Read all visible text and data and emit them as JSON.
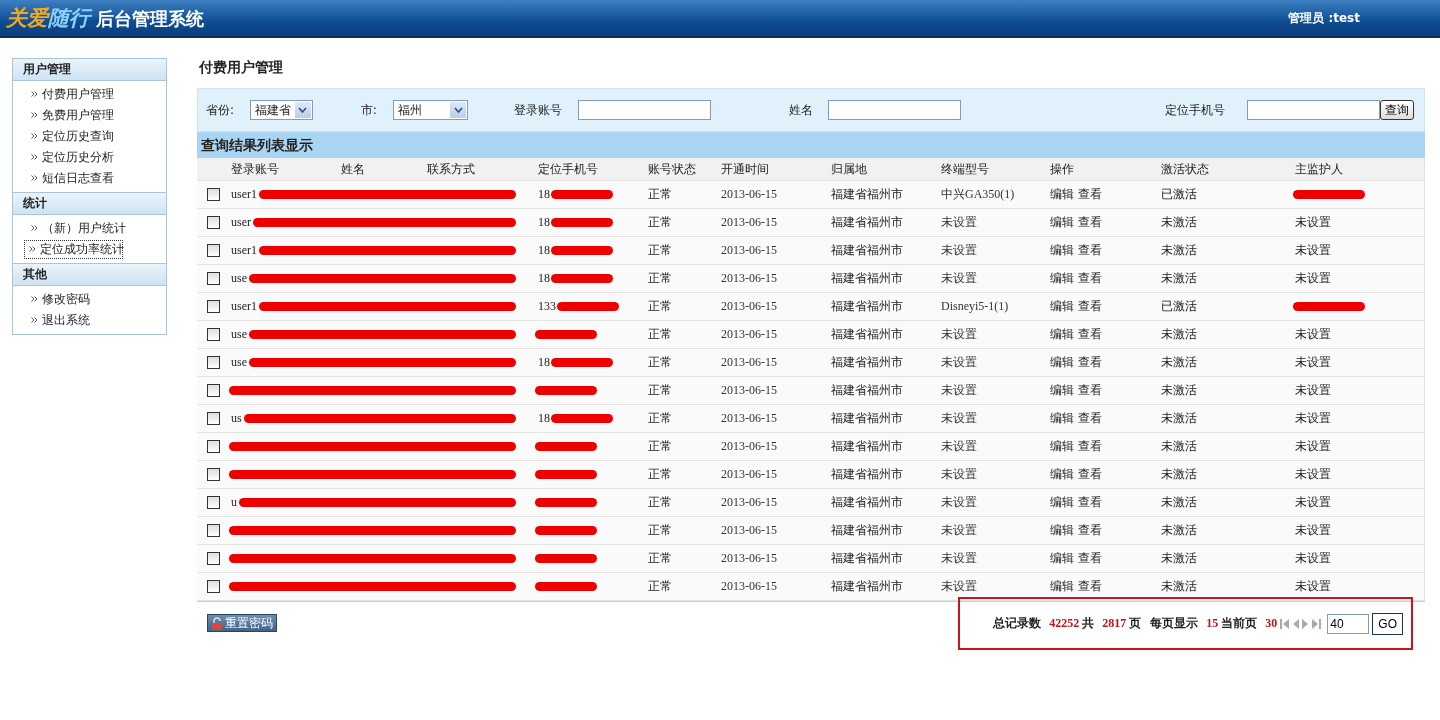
{
  "header": {
    "logo_part_1": "关爱",
    "logo_part_2": "随行",
    "system_name": "后台管理系统",
    "admin": "管理员 :test"
  },
  "sidebar": [
    {
      "title": "用户管理",
      "items": [
        {
          "label": "付费用户管理",
          "focused": false
        },
        {
          "label": "免费用户管理",
          "focused": false
        },
        {
          "label": "定位历史查询",
          "focused": false
        },
        {
          "label": "定位历史分析",
          "focused": false
        },
        {
          "label": "短信日志查看",
          "focused": false
        }
      ]
    },
    {
      "title": "统计",
      "items": [
        {
          "label": "（新）用户统计",
          "focused": false
        },
        {
          "label": "定位成功率统计",
          "focused": true
        }
      ]
    },
    {
      "title": "其他",
      "items": [
        {
          "label": "修改密码",
          "focused": false
        },
        {
          "label": "退出系统",
          "focused": false
        }
      ]
    }
  ],
  "page_title": "付费用户管理",
  "filters": {
    "province_label": "省份:",
    "province": "福建省",
    "city_label": "市:",
    "city": "福州",
    "account_label": "登录账号",
    "name_label": "姓名",
    "phone_label": "定位手机号",
    "query_button": "查询"
  },
  "results_title": "查询结果列表显示",
  "columns": [
    "登录账号",
    "姓名",
    "联系方式",
    "定位手机号",
    "账号状态",
    "开通时间",
    "归属地",
    "终端型号",
    "操作",
    "激活状态",
    "主监护人"
  ],
  "rows": [
    {
      "checked": false,
      "account": "user1",
      "phone": "18",
      "status": "正常",
      "date": "2013-06-15",
      "region": "福建省福州市",
      "terminal": "中兴GA350(1)",
      "edit": "编辑",
      "view": "查看",
      "activation": "已激活",
      "activated": true,
      "guardian": "",
      "guardian_redacted": true
    },
    {
      "checked": false,
      "account": "user",
      "phone": "18",
      "status": "正常",
      "date": "2013-06-15",
      "region": "福建省福州市",
      "terminal": "未设置",
      "edit": "编辑",
      "view": "查看",
      "activation": "未激活",
      "activated": false,
      "guardian": "未设置",
      "guardian_redacted": false
    },
    {
      "checked": false,
      "account": "user1",
      "phone": "18",
      "status": "正常",
      "date": "2013-06-15",
      "region": "福建省福州市",
      "terminal": "未设置",
      "edit": "编辑",
      "view": "查看",
      "activation": "未激活",
      "activated": false,
      "guardian": "未设置",
      "guardian_redacted": false
    },
    {
      "checked": false,
      "account": "use",
      "phone": "18",
      "status": "正常",
      "date": "2013-06-15",
      "region": "福建省福州市",
      "terminal": "未设置",
      "edit": "编辑",
      "view": "查看",
      "activation": "未激活",
      "activated": false,
      "guardian": "未设置",
      "guardian_redacted": false
    },
    {
      "checked": false,
      "account": "user1",
      "phone": "133",
      "status": "正常",
      "date": "2013-06-15",
      "region": "福建省福州市",
      "terminal": "Disneyi5-1(1)",
      "edit": "编辑",
      "view": "查看",
      "activation": "已激活",
      "activated": true,
      "guardian": "",
      "guardian_redacted": true
    },
    {
      "checked": false,
      "account": "use",
      "phone": "",
      "status": "正常",
      "date": "2013-06-15",
      "region": "福建省福州市",
      "terminal": "未设置",
      "edit": "编辑",
      "view": "查看",
      "activation": "未激活",
      "activated": false,
      "guardian": "未设置",
      "guardian_redacted": false
    },
    {
      "checked": false,
      "account": "use",
      "phone": "18",
      "status": "正常",
      "date": "2013-06-15",
      "region": "福建省福州市",
      "terminal": "未设置",
      "edit": "编辑",
      "view": "查看",
      "activation": "未激活",
      "activated": false,
      "guardian": "未设置",
      "guardian_redacted": false
    },
    {
      "checked": false,
      "account": "",
      "phone": "",
      "status": "正常",
      "date": "2013-06-15",
      "region": "福建省福州市",
      "terminal": "未设置",
      "edit": "编辑",
      "view": "查看",
      "activation": "未激活",
      "activated": false,
      "guardian": "未设置",
      "guardian_redacted": false
    },
    {
      "checked": false,
      "account": "us",
      "phone": "18",
      "status": "正常",
      "date": "2013-06-15",
      "region": "福建省福州市",
      "terminal": "未设置",
      "edit": "编辑",
      "view": "查看",
      "activation": "未激活",
      "activated": false,
      "guardian": "未设置",
      "guardian_redacted": false
    },
    {
      "checked": false,
      "account": "",
      "phone": "",
      "status": "正常",
      "date": "2013-06-15",
      "region": "福建省福州市",
      "terminal": "未设置",
      "edit": "编辑",
      "view": "查看",
      "activation": "未激活",
      "activated": false,
      "guardian": "未设置",
      "guardian_redacted": false
    },
    {
      "checked": false,
      "account": "",
      "phone": "",
      "status": "正常",
      "date": "2013-06-15",
      "region": "福建省福州市",
      "terminal": "未设置",
      "edit": "编辑",
      "view": "查看",
      "activation": "未激活",
      "activated": false,
      "guardian": "未设置",
      "guardian_redacted": false
    },
    {
      "checked": false,
      "account": "u",
      "phone": "",
      "status": "正常",
      "date": "2013-06-15",
      "region": "福建省福州市",
      "terminal": "未设置",
      "edit": "编辑",
      "view": "查看",
      "activation": "未激活",
      "activated": false,
      "guardian": "未设置",
      "guardian_redacted": false
    },
    {
      "checked": false,
      "account": "",
      "phone": "",
      "status": "正常",
      "date": "2013-06-15",
      "region": "福建省福州市",
      "terminal": "未设置",
      "edit": "编辑",
      "view": "查看",
      "activation": "未激活",
      "activated": false,
      "guardian": "未设置",
      "guardian_redacted": false
    },
    {
      "checked": false,
      "account": "",
      "phone": "",
      "status": "正常",
      "date": "2013-06-15",
      "region": "福建省福州市",
      "terminal": "未设置",
      "edit": "编辑",
      "view": "查看",
      "activation": "未激活",
      "activated": false,
      "guardian": "未设置",
      "guardian_redacted": false
    },
    {
      "checked": false,
      "account": "",
      "phone": "",
      "status": "正常",
      "date": "2013-06-15",
      "region": "福建省福州市",
      "terminal": "未设置",
      "edit": "编辑",
      "view": "查看",
      "activation": "未激活",
      "activated": false,
      "guardian": "未设置",
      "guardian_redacted": false
    }
  ],
  "reset_button": "重置密码",
  "pagination": {
    "total_label": "总记录数",
    "total": "42252",
    "pages_label": "共",
    "pages": "2817",
    "pages_unit": "页",
    "per_page_label": "每页显示",
    "per_page": "15",
    "current_label": "当前页",
    "current": "30",
    "goto_value": "40",
    "go_button": "GO"
  }
}
